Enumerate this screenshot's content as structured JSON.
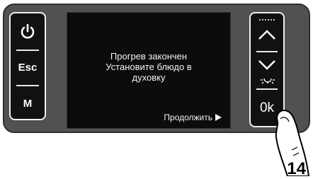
{
  "left_keys": {
    "power_icon": "power-icon",
    "esc_label": "Esc",
    "m_label": "M"
  },
  "screen": {
    "message_line1": "Прогрев закончен",
    "message_line2": "Установите блюдо в",
    "message_line3": "духовку",
    "continue_label": "Продолжить",
    "continue_icon": "play-right-icon"
  },
  "right_keys": {
    "up_icon": "chevron-up-icon",
    "down_icon": "chevron-down-icon",
    "ok_label": "0k"
  },
  "figure_number": "14"
}
